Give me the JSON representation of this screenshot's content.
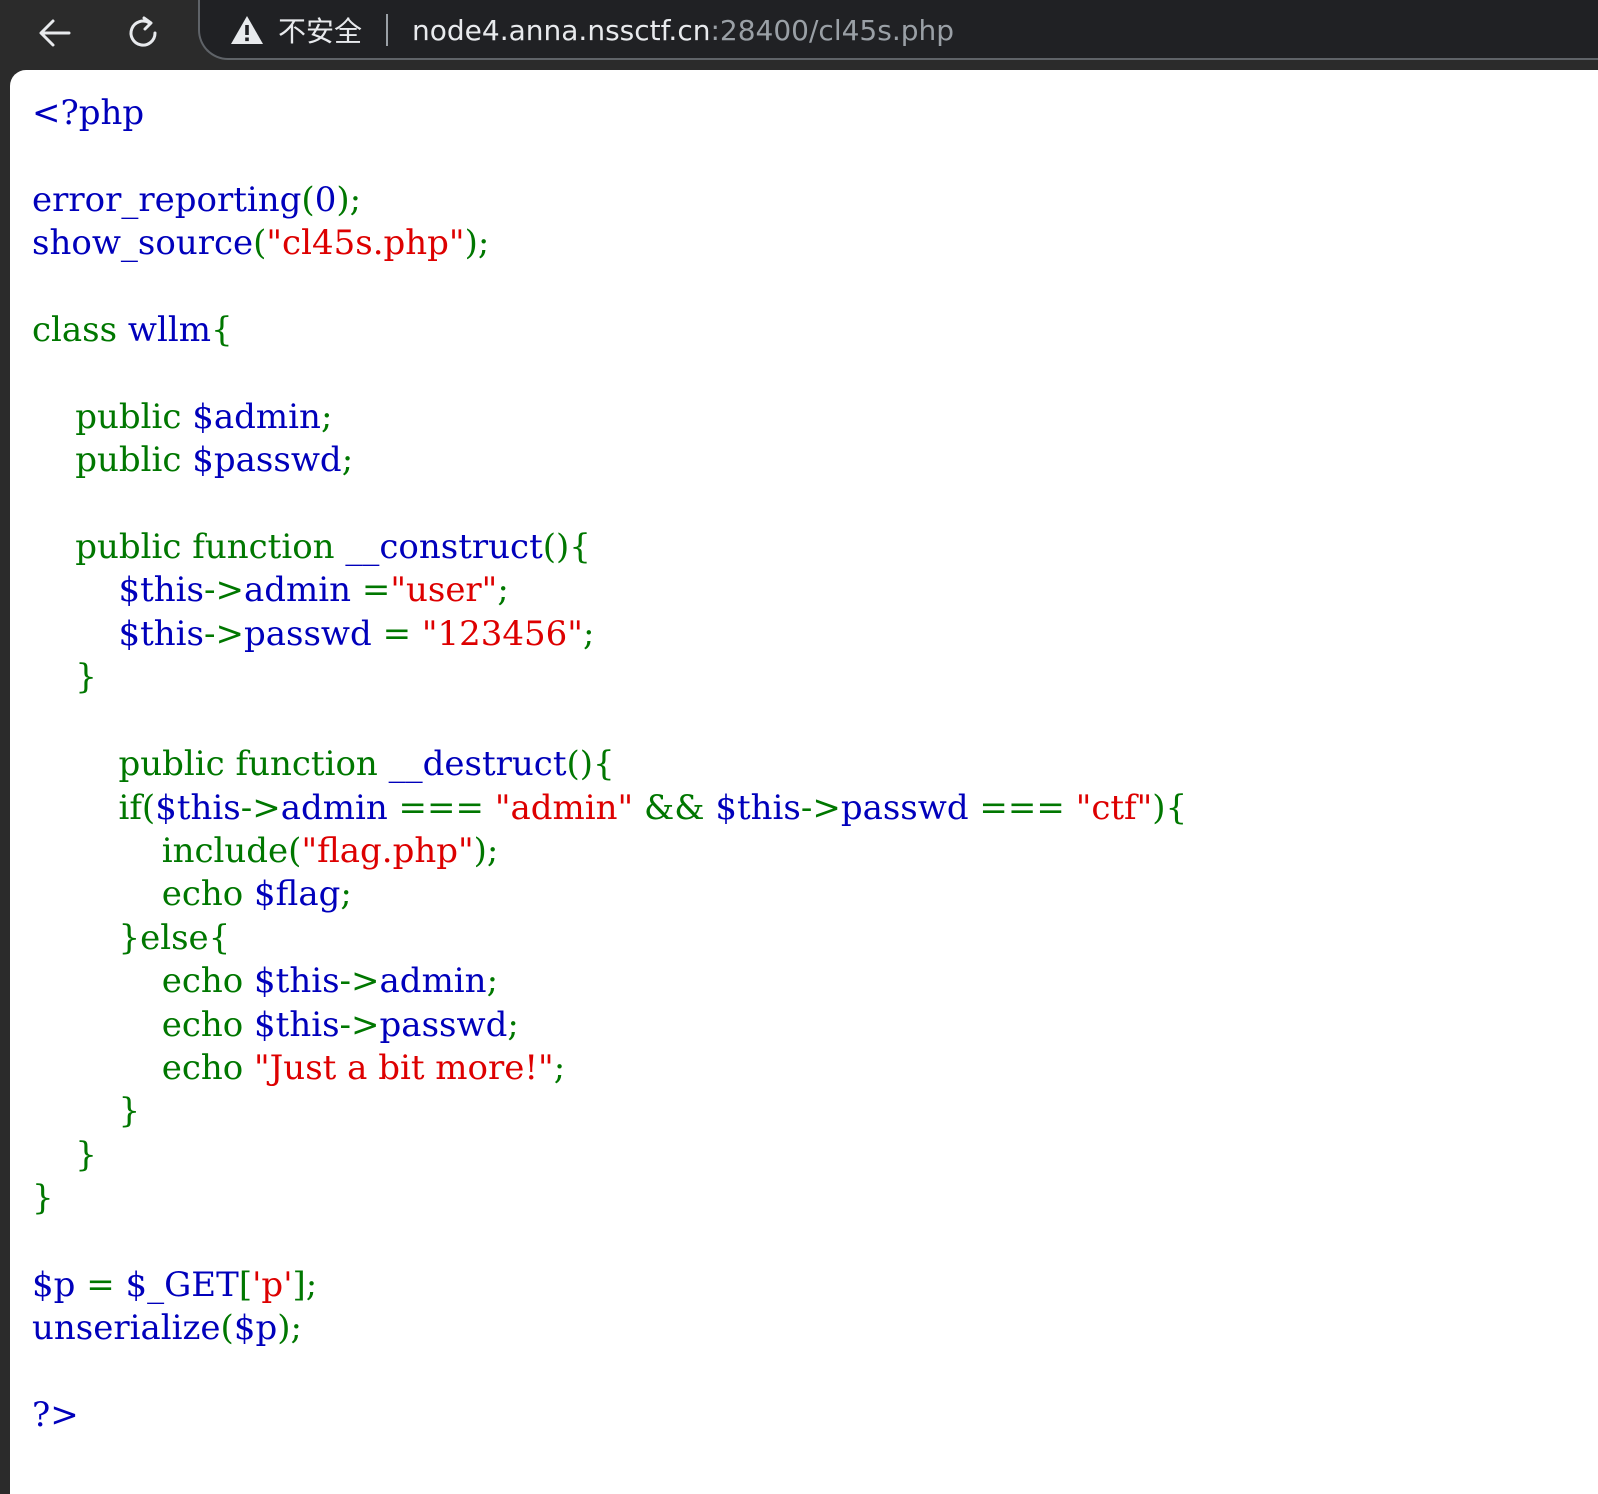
{
  "browser": {
    "security_label": "不安全",
    "url_host": "node4.anna.nssctf.cn",
    "url_rest": ":28400/cl45s.php"
  },
  "colors": {
    "default": "#0000BB",
    "keyword": "#007700",
    "string": "#DD0000"
  },
  "code_lines": [
    [
      [
        "d",
        "<?php"
      ]
    ],
    [],
    [
      [
        "d",
        "error_reporting"
      ],
      [
        "k",
        "("
      ],
      [
        "d",
        "0"
      ],
      [
        "k",
        ");"
      ]
    ],
    [
      [
        "d",
        "show_source"
      ],
      [
        "k",
        "("
      ],
      [
        "s",
        "\"cl45s.php\""
      ],
      [
        "k",
        ");"
      ]
    ],
    [],
    [
      [
        "k",
        "class "
      ],
      [
        "d",
        "wllm"
      ],
      [
        "k",
        "{"
      ]
    ],
    [],
    [
      [
        "k",
        "    public "
      ],
      [
        "d",
        "$admin"
      ],
      [
        "k",
        ";"
      ]
    ],
    [
      [
        "k",
        "    public "
      ],
      [
        "d",
        "$passwd"
      ],
      [
        "k",
        ";"
      ]
    ],
    [],
    [
      [
        "k",
        "    public function "
      ],
      [
        "d",
        "__construct"
      ],
      [
        "k",
        "(){"
      ]
    ],
    [
      [
        "k",
        "        "
      ],
      [
        "d",
        "$this"
      ],
      [
        "k",
        "->"
      ],
      [
        "d",
        "admin "
      ],
      [
        "k",
        "="
      ],
      [
        "s",
        "\"user\""
      ],
      [
        "k",
        ";"
      ]
    ],
    [
      [
        "k",
        "        "
      ],
      [
        "d",
        "$this"
      ],
      [
        "k",
        "->"
      ],
      [
        "d",
        "passwd "
      ],
      [
        "k",
        "= "
      ],
      [
        "s",
        "\"123456\""
      ],
      [
        "k",
        ";"
      ]
    ],
    [
      [
        "k",
        "    }"
      ]
    ],
    [],
    [
      [
        "k",
        "        public function "
      ],
      [
        "d",
        "__destruct"
      ],
      [
        "k",
        "(){"
      ]
    ],
    [
      [
        "k",
        "        if("
      ],
      [
        "d",
        "$this"
      ],
      [
        "k",
        "->"
      ],
      [
        "d",
        "admin "
      ],
      [
        "k",
        "=== "
      ],
      [
        "s",
        "\"admin\" "
      ],
      [
        "k",
        "&& "
      ],
      [
        "d",
        "$this"
      ],
      [
        "k",
        "->"
      ],
      [
        "d",
        "passwd "
      ],
      [
        "k",
        "=== "
      ],
      [
        "s",
        "\"ctf\""
      ],
      [
        "k",
        "){"
      ]
    ],
    [
      [
        "k",
        "            include("
      ],
      [
        "s",
        "\"flag.php\""
      ],
      [
        "k",
        ");"
      ]
    ],
    [
      [
        "k",
        "            echo "
      ],
      [
        "d",
        "$flag"
      ],
      [
        "k",
        ";"
      ]
    ],
    [
      [
        "k",
        "        }else{"
      ]
    ],
    [
      [
        "k",
        "            echo "
      ],
      [
        "d",
        "$this"
      ],
      [
        "k",
        "->"
      ],
      [
        "d",
        "admin"
      ],
      [
        "k",
        ";"
      ]
    ],
    [
      [
        "k",
        "            echo "
      ],
      [
        "d",
        "$this"
      ],
      [
        "k",
        "->"
      ],
      [
        "d",
        "passwd"
      ],
      [
        "k",
        ";"
      ]
    ],
    [
      [
        "k",
        "            echo "
      ],
      [
        "s",
        "\"Just a bit more!\""
      ],
      [
        "k",
        ";"
      ]
    ],
    [
      [
        "k",
        "        }"
      ]
    ],
    [
      [
        "k",
        "    }"
      ]
    ],
    [
      [
        "k",
        "}"
      ]
    ],
    [],
    [
      [
        "d",
        "$p "
      ],
      [
        "k",
        "= "
      ],
      [
        "d",
        "$_GET"
      ],
      [
        "k",
        "["
      ],
      [
        "s",
        "'p'"
      ],
      [
        "k",
        "];"
      ]
    ],
    [
      [
        "d",
        "unserialize"
      ],
      [
        "k",
        "("
      ],
      [
        "d",
        "$p"
      ],
      [
        "k",
        ");"
      ]
    ],
    [],
    [
      [
        "d",
        "?>"
      ]
    ]
  ]
}
